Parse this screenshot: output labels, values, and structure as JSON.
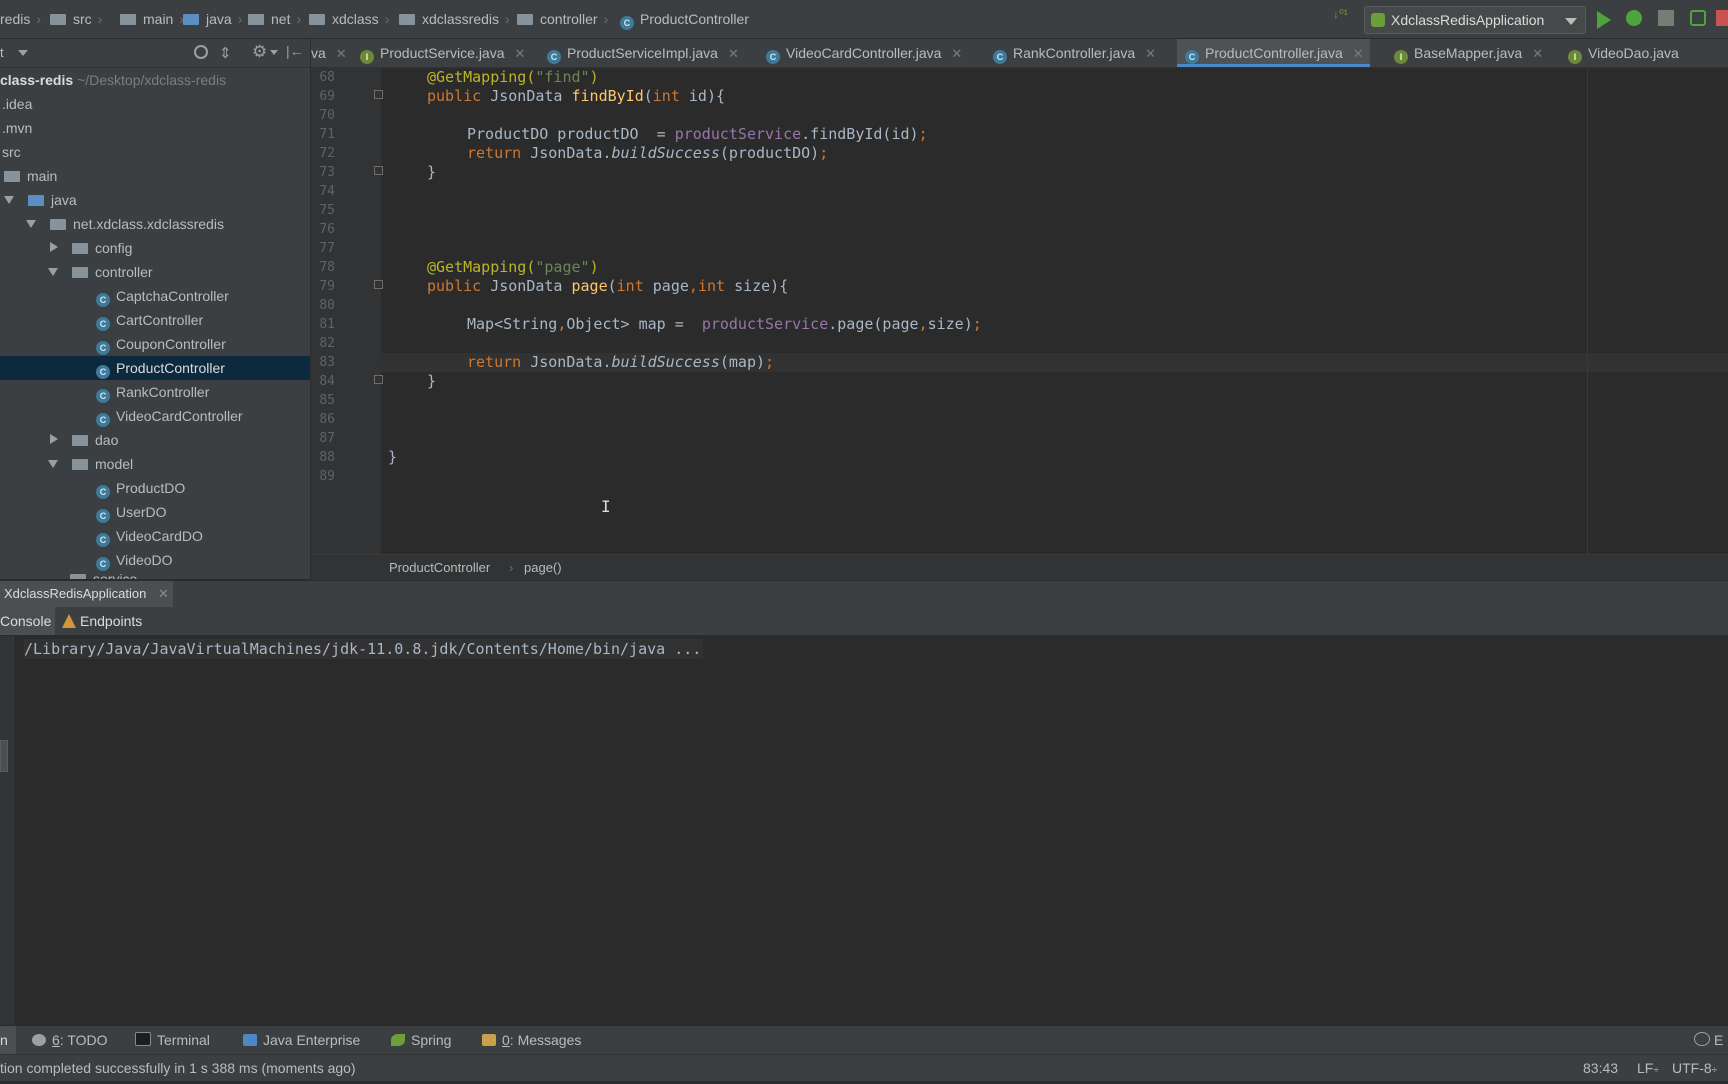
{
  "breadcrumbs": [
    "redis",
    "src",
    "main",
    "java",
    "net",
    "xdclass",
    "xdclassredis",
    "controller",
    "ProductController"
  ],
  "run_config": "XdclassRedisApplication",
  "project": {
    "root_name": "class-redis",
    "root_path": "~/Desktop/xdclass-redis",
    "items": [
      {
        "label": ".idea"
      },
      {
        "label": ".mvn"
      },
      {
        "label": "src"
      },
      {
        "label": "main"
      },
      {
        "label": "java"
      },
      {
        "label": "net.xdclass.xdclassredis"
      },
      {
        "label": "config"
      },
      {
        "label": "controller"
      },
      {
        "label": "CaptchaController"
      },
      {
        "label": "CartController"
      },
      {
        "label": "CouponController"
      },
      {
        "label": "ProductController"
      },
      {
        "label": "RankController"
      },
      {
        "label": "VideoCardController"
      },
      {
        "label": "dao"
      },
      {
        "label": "model"
      },
      {
        "label": "ProductDO"
      },
      {
        "label": "UserDO"
      },
      {
        "label": "VideoCardDO"
      },
      {
        "label": "VideoDO"
      },
      {
        "label": "service"
      }
    ]
  },
  "tabs": [
    {
      "label": "va"
    },
    {
      "label": "ProductService.java"
    },
    {
      "label": "ProductServiceImpl.java"
    },
    {
      "label": "VideoCardController.java"
    },
    {
      "label": "RankController.java"
    },
    {
      "label": "ProductController.java",
      "active": true
    },
    {
      "label": "BaseMapper.java"
    },
    {
      "label": "VideoDao.java"
    }
  ],
  "editor": {
    "line_numbers": [
      "68",
      "69",
      "70",
      "71",
      "72",
      "73",
      "74",
      "75",
      "76",
      "77",
      "78",
      "79",
      "80",
      "81",
      "82",
      "83",
      "84",
      "85",
      "86",
      "87",
      "88",
      "89"
    ],
    "code": {
      "l68_ann": "@GetMapping(",
      "l68_str": "\"find\"",
      "l68_end": ")",
      "l69_kw": "public ",
      "l69_type": "JsonData ",
      "l69_fn": "findById",
      "l69_p1": "(",
      "l69_kw2": "int ",
      "l69_end": "id){",
      "l71_a": "ProductDO productDO  = ",
      "l71_fld": "productService",
      "l71_b": ".findById(id)",
      "l71_semi": ";",
      "l72_kw": "return ",
      "l72_a": "JsonData.",
      "l72_it": "buildSuccess",
      "l72_b": "(productDO)",
      "l72_semi": ";",
      "l73": "}",
      "l78_ann": "@GetMapping(",
      "l78_str": "\"page\"",
      "l78_end": ")",
      "l79_kw": "public ",
      "l79_type": "JsonData ",
      "l79_fn": "page",
      "l79_p1": "(",
      "l79_kw2": "int ",
      "l79_mid": "page",
      "l79_comma": ",",
      "l79_kw3": "int ",
      "l79_end": "size){",
      "l81_a": "Map<String",
      "l81_comma": ",",
      "l81_b": "Object> map =  ",
      "l81_fld": "productService",
      "l81_c": ".page(page",
      "l81_comma2": ",",
      "l81_d": "size)",
      "l81_semi": ";",
      "l83_kw": "return ",
      "l83_a": "JsonData.",
      "l83_it": "buildSuccess",
      "l83_b": "(map)",
      "l83_semi": ";",
      "l84": "}",
      "l88": "}"
    }
  },
  "editor_breadcrumb": {
    "class": "ProductController",
    "method": "page()"
  },
  "run_window": {
    "title": "XdclassRedisApplication",
    "tabs": [
      "Console",
      "Endpoints"
    ],
    "console_line": "/Library/Java/JavaVirtualMachines/jdk-11.0.8.jdk/Contents/Home/bin/java ..."
  },
  "toolwindows": {
    "run_stub": "n",
    "todo_num": "6",
    "todo_label": ": TODO",
    "terminal": "Terminal",
    "java_enterprise": "Java Enterprise",
    "spring": "Spring",
    "messages_num": "0",
    "messages_label": ": Messages",
    "event_stub": "E"
  },
  "status": {
    "message": "tion completed successfully in 1 s 388 ms (moments ago)",
    "position": "83:43",
    "line_sep": "LF",
    "encoding": "UTF-8"
  }
}
